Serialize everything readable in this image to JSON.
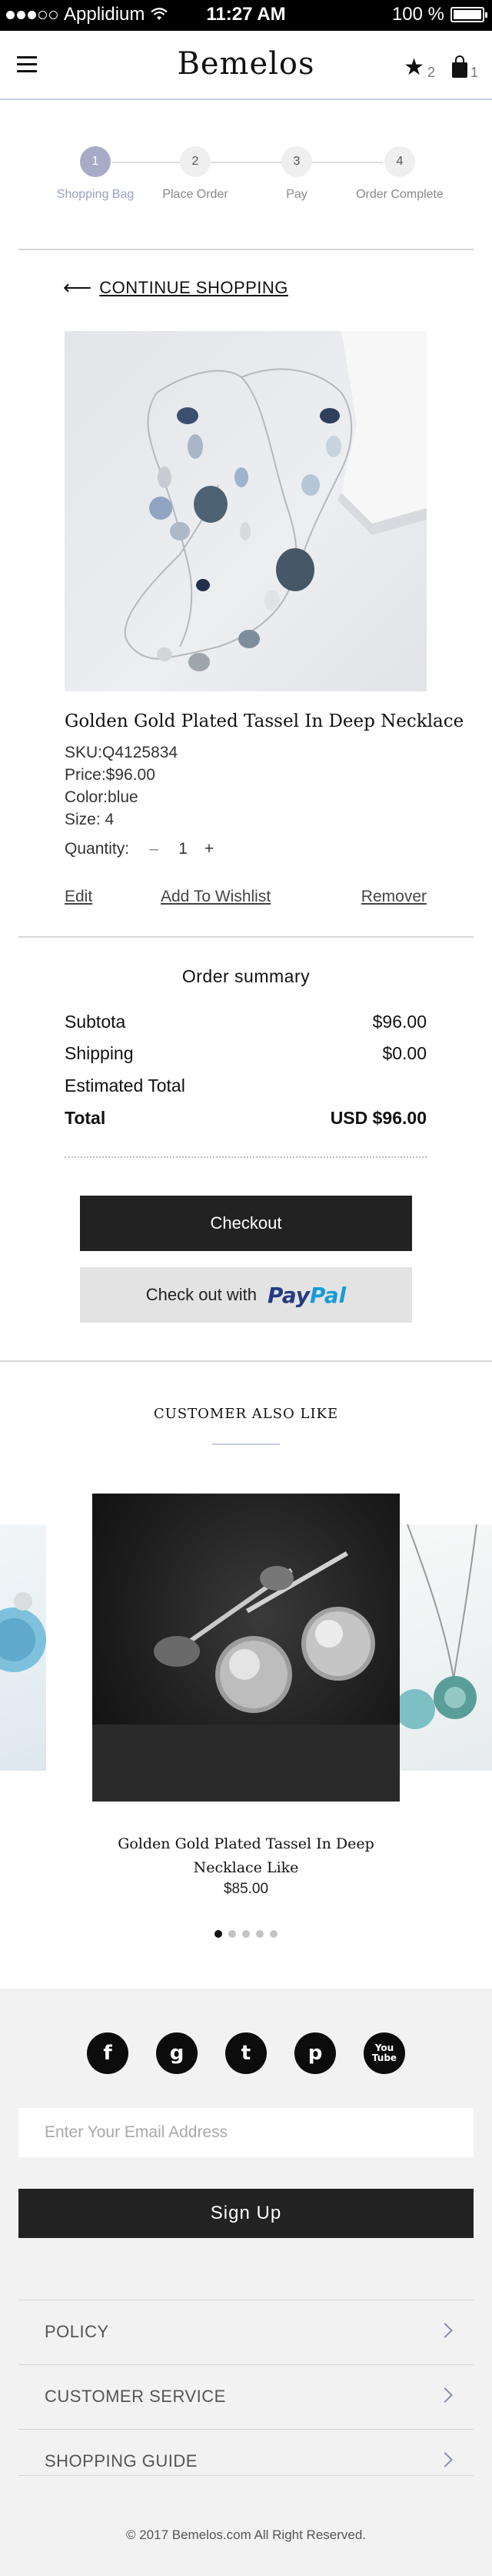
{
  "status_bar": {
    "carrier": "Applidium",
    "time": "11:27 AM",
    "battery": "100 %",
    "battery_level": 1.0
  },
  "header": {
    "logo": "Bemelos",
    "wishlist_count": "2",
    "bag_count": "1"
  },
  "steps": [
    {
      "num": "1",
      "label": "Shopping Bag",
      "active": true
    },
    {
      "num": "2",
      "label": "Place Order",
      "active": false
    },
    {
      "num": "3",
      "label": "Pay",
      "active": false
    },
    {
      "num": "4",
      "label": "Order Complete",
      "active": false
    }
  ],
  "continue_label": "CONTINUE SHOPPING",
  "product": {
    "name": "Golden Gold Plated Tassel In Deep Necklace",
    "sku": "SKU:Q4125834",
    "price": "Price:$96.00",
    "color": "Color:blue",
    "size": "Size: 4",
    "quantity_label": "Quantity:",
    "minus": "–",
    "quantity": "1",
    "plus": "+",
    "actions": {
      "edit": "Edit",
      "wishlist": "Add To Wishlist",
      "remove": "Remover"
    }
  },
  "summary": {
    "title": "Order  summary",
    "subtotal_label": "Subtota",
    "subtotal": "$96.00",
    "shipping_label": "Shipping",
    "shipping": "$0.00",
    "estimated_label": "Estimated Total",
    "total_label": "Total",
    "total": "USD $96.00"
  },
  "buttons": {
    "checkout": "Checkout",
    "paypal_prefix": "Check out with",
    "paypal_pay": "Pay",
    "paypal_pal": "Pal"
  },
  "also_like": {
    "title": "CUSTOMER ALSO LIKE",
    "item_name": "Golden Gold Plated Tassel In Deep Necklace Like",
    "item_price": "$85.00",
    "dots": 5,
    "active_dot": 0
  },
  "footer": {
    "social": [
      {
        "name": "facebook",
        "glyph": "f"
      },
      {
        "name": "google",
        "glyph": "g"
      },
      {
        "name": "twitter",
        "glyph": "t"
      },
      {
        "name": "pinterest",
        "glyph": "p"
      },
      {
        "name": "youtube",
        "glyph": "You Tube"
      }
    ],
    "email_placeholder": "Enter Your Email Address",
    "signup": "Sign Up",
    "links": [
      "POLICY",
      "CUSTOMER SERVICE",
      "SHOPPING GUIDE"
    ],
    "copyright": "© 2017 Bemelos.com All Right Reserved."
  }
}
